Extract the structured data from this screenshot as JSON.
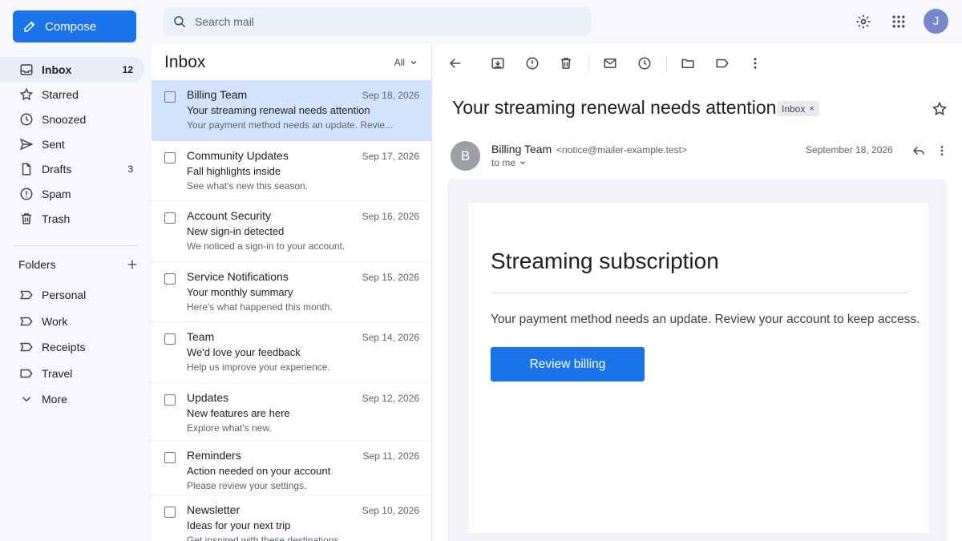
{
  "compose": {
    "label": "Compose",
    "icon": "pencil-icon"
  },
  "search": {
    "placeholder": "Search mail"
  },
  "account": {
    "initial": "J"
  },
  "nav": {
    "items": [
      {
        "label": "Inbox",
        "count": "12",
        "icon": "inbox-icon",
        "active": true
      },
      {
        "label": "Starred",
        "count": "",
        "icon": "star-icon"
      },
      {
        "label": "Snoozed",
        "count": "",
        "icon": "clock-icon"
      },
      {
        "label": "Sent",
        "count": "",
        "icon": "send-icon"
      },
      {
        "label": "Drafts",
        "count": "3",
        "icon": "draft-icon"
      },
      {
        "label": "Spam",
        "count": "",
        "icon": "spam-icon"
      },
      {
        "label": "Trash",
        "count": "",
        "icon": "trash-icon"
      }
    ]
  },
  "folders": {
    "heading": "Folders",
    "items": [
      {
        "label": "Personal",
        "icon": "label-icon"
      },
      {
        "label": "Work",
        "icon": "label-icon"
      },
      {
        "label": "Receipts",
        "icon": "label-icon"
      },
      {
        "label": "Travel",
        "icon": "label-icon"
      },
      {
        "label": "More",
        "icon": "chevron-down-icon"
      }
    ]
  },
  "list": {
    "title": "Inbox",
    "filter": "All",
    "messages": [
      {
        "sender": "Billing Team",
        "date": "Sep 18, 2026",
        "subject": "Your streaming renewal needs attention",
        "snippet": "Your payment method needs an update. Revie...",
        "selected": true
      },
      {
        "sender": "Community Updates",
        "date": "Sep 17, 2026",
        "subject": "Fall highlights inside",
        "snippet": "See what's new this season."
      },
      {
        "sender": "Account Security",
        "date": "Sep 16, 2026",
        "subject": "New sign-in detected",
        "snippet": "We noticed a sign-in to your account."
      },
      {
        "sender": "Service Notifications",
        "date": "Sep 15, 2026",
        "subject": "Your monthly summary",
        "snippet": "Here's what happened this month."
      },
      {
        "sender": "Team",
        "date": "Sep 14, 2026",
        "subject": "We'd love your feedback",
        "snippet": "Help us improve your experience."
      },
      {
        "sender": "Updates",
        "date": "Sep 12, 2026",
        "subject": "New features are here",
        "snippet": "Explore what's new."
      },
      {
        "sender": "Reminders",
        "date": "Sep 11, 2026",
        "subject": "Action needed on your account",
        "snippet": "Please review your settings."
      },
      {
        "sender": "Newsletter",
        "date": "Sep 10, 2026",
        "subject": "Ideas for your next trip",
        "snippet": "Get inspired with these destinations."
      }
    ]
  },
  "message": {
    "subject": "Your streaming renewal needs attention",
    "label_chip": "Inbox",
    "label_chip_close": "×",
    "sender_initial": "B",
    "sender_name": "Billing Team",
    "sender_email": "<notice@mailer-example.test>",
    "recipient": "to me",
    "date": "September 18, 2026",
    "email_heading": "Streaming subscription",
    "email_body": "Your payment method needs an update. Review your account to keep access.",
    "email_button": "Review billing"
  },
  "colors": {
    "accent": "#1a73e8",
    "selected_row": "#d3e3fd",
    "active_nav": "#e7ecf7"
  }
}
